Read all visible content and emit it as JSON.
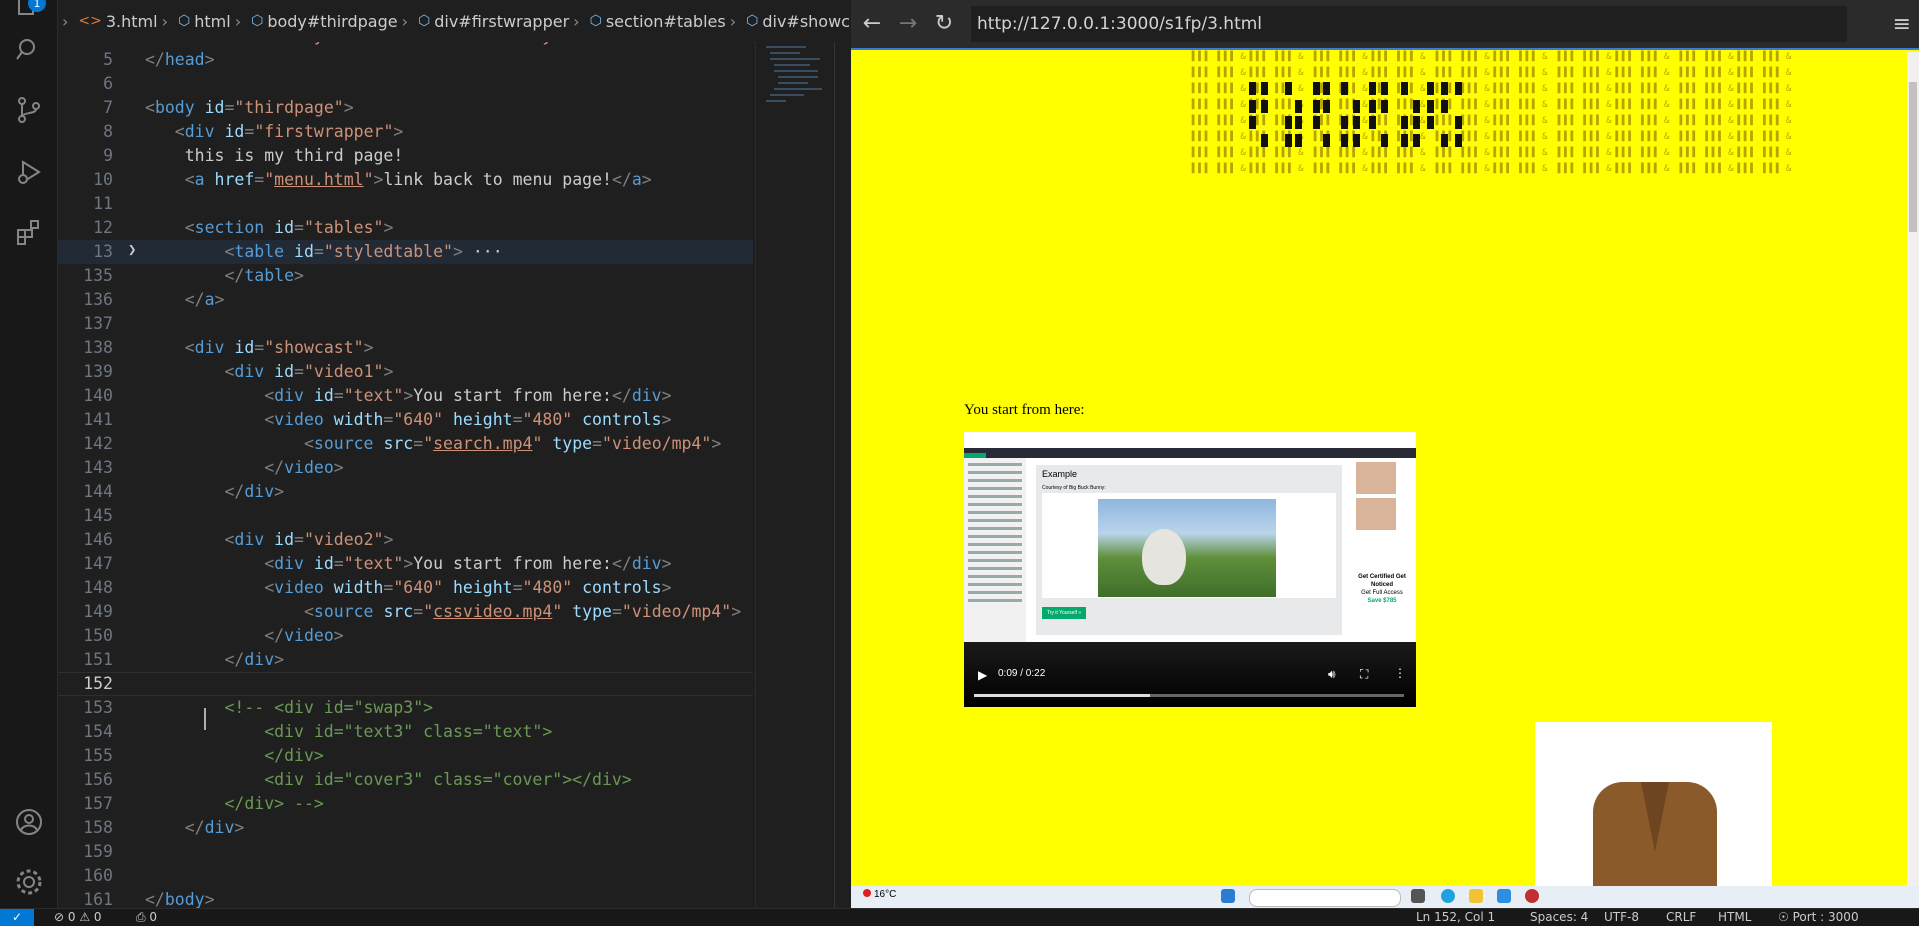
{
  "activity_bar": {
    "badge": "1"
  },
  "breadcrumb": [
    "3.html",
    "html",
    "body#thirdpage",
    "div#firstwrapper",
    "section#tables",
    "div#showcast"
  ],
  "editor": {
    "lines": [
      {
        "n": "",
        "parts": [
          [
            "p",
            "    <"
          ],
          [
            "t",
            "link "
          ],
          [
            "a",
            "rel"
          ],
          [
            "p",
            "="
          ],
          [
            "s",
            "\"stylesheet\" "
          ],
          [
            "a",
            "href"
          ],
          [
            "p",
            "="
          ],
          [
            "s",
            "\"thirdstyle.css\""
          ],
          [
            "p",
            " >"
          ]
        ]
      },
      {
        "n": "5",
        "parts": [
          [
            "p",
            "</"
          ],
          [
            "t",
            "head"
          ],
          [
            "p",
            ">"
          ]
        ]
      },
      {
        "n": "6",
        "parts": []
      },
      {
        "n": "7",
        "parts": [
          [
            "p",
            "<"
          ],
          [
            "t",
            "body "
          ],
          [
            "a",
            "id"
          ],
          [
            "p",
            "="
          ],
          [
            "s",
            "\"thirdpage\""
          ],
          [
            "p",
            ">"
          ]
        ]
      },
      {
        "n": "8",
        "parts": [
          [
            "p",
            "   <"
          ],
          [
            "t",
            "div "
          ],
          [
            "a",
            "id"
          ],
          [
            "p",
            "="
          ],
          [
            "s",
            "\"firstwrapper\""
          ],
          [
            "p",
            ">"
          ]
        ]
      },
      {
        "n": "9",
        "parts": [
          [
            "txt",
            "    this is my third page!"
          ]
        ]
      },
      {
        "n": "10",
        "parts": [
          [
            "p",
            "    <"
          ],
          [
            "t",
            "a "
          ],
          [
            "a",
            "href"
          ],
          [
            "p",
            "="
          ],
          [
            "s",
            "\""
          ],
          [
            "su",
            "menu.html"
          ],
          [
            "s",
            "\""
          ],
          [
            "p",
            ">"
          ],
          [
            "txt",
            "link back to menu page!"
          ],
          [
            "p",
            "</"
          ],
          [
            "t",
            "a"
          ],
          [
            "p",
            ">"
          ]
        ]
      },
      {
        "n": "11",
        "parts": []
      },
      {
        "n": "12",
        "parts": [
          [
            "p",
            "    <"
          ],
          [
            "t",
            "section "
          ],
          [
            "a",
            "id"
          ],
          [
            "p",
            "="
          ],
          [
            "s",
            "\"tables\""
          ],
          [
            "p",
            ">"
          ]
        ]
      },
      {
        "n": "13",
        "parts": [
          [
            "p",
            "        <"
          ],
          [
            "t",
            "table "
          ],
          [
            "a",
            "id"
          ],
          [
            "p",
            "="
          ],
          [
            "s",
            "\"styledtable\""
          ],
          [
            "p",
            ">"
          ],
          [
            "txt",
            " ···"
          ]
        ]
      },
      {
        "n": "135",
        "parts": [
          [
            "p",
            "        </"
          ],
          [
            "t",
            "table"
          ],
          [
            "p",
            ">"
          ]
        ]
      },
      {
        "n": "136",
        "parts": [
          [
            "p",
            "    </"
          ],
          [
            "t",
            "a"
          ],
          [
            "p",
            ">"
          ]
        ]
      },
      {
        "n": "137",
        "parts": []
      },
      {
        "n": "138",
        "parts": [
          [
            "p",
            "    <"
          ],
          [
            "t",
            "div "
          ],
          [
            "a",
            "id"
          ],
          [
            "p",
            "="
          ],
          [
            "s",
            "\"showcast\""
          ],
          [
            "p",
            ">"
          ]
        ]
      },
      {
        "n": "139",
        "parts": [
          [
            "p",
            "        <"
          ],
          [
            "t",
            "div "
          ],
          [
            "a",
            "id"
          ],
          [
            "p",
            "="
          ],
          [
            "s",
            "\"video1\""
          ],
          [
            "p",
            ">"
          ]
        ]
      },
      {
        "n": "140",
        "parts": [
          [
            "p",
            "            <"
          ],
          [
            "t",
            "div "
          ],
          [
            "a",
            "id"
          ],
          [
            "p",
            "="
          ],
          [
            "s",
            "\"text\""
          ],
          [
            "p",
            ">"
          ],
          [
            "txt",
            "You start from here:"
          ],
          [
            "p",
            "</"
          ],
          [
            "t",
            "div"
          ],
          [
            "p",
            ">"
          ]
        ]
      },
      {
        "n": "141",
        "parts": [
          [
            "p",
            "            <"
          ],
          [
            "t",
            "video "
          ],
          [
            "a",
            "width"
          ],
          [
            "p",
            "="
          ],
          [
            "s",
            "\"640\" "
          ],
          [
            "a",
            "height"
          ],
          [
            "p",
            "="
          ],
          [
            "s",
            "\"480\" "
          ],
          [
            "a",
            "controls"
          ],
          [
            "p",
            ">"
          ]
        ]
      },
      {
        "n": "142",
        "parts": [
          [
            "p",
            "                <"
          ],
          [
            "t",
            "source "
          ],
          [
            "a",
            "src"
          ],
          [
            "p",
            "="
          ],
          [
            "s",
            "\""
          ],
          [
            "su",
            "search.mp4"
          ],
          [
            "s",
            "\" "
          ],
          [
            "a",
            "type"
          ],
          [
            "p",
            "="
          ],
          [
            "s",
            "\"video/mp4\""
          ],
          [
            "p",
            ">"
          ]
        ]
      },
      {
        "n": "143",
        "parts": [
          [
            "p",
            "            </"
          ],
          [
            "t",
            "video"
          ],
          [
            "p",
            ">"
          ]
        ]
      },
      {
        "n": "144",
        "parts": [
          [
            "p",
            "        </"
          ],
          [
            "t",
            "div"
          ],
          [
            "p",
            ">"
          ]
        ]
      },
      {
        "n": "145",
        "parts": []
      },
      {
        "n": "146",
        "parts": [
          [
            "p",
            "        <"
          ],
          [
            "t",
            "div "
          ],
          [
            "a",
            "id"
          ],
          [
            "p",
            "="
          ],
          [
            "s",
            "\"video2\""
          ],
          [
            "p",
            ">"
          ]
        ]
      },
      {
        "n": "147",
        "parts": [
          [
            "p",
            "            <"
          ],
          [
            "t",
            "div "
          ],
          [
            "a",
            "id"
          ],
          [
            "p",
            "="
          ],
          [
            "s",
            "\"text\""
          ],
          [
            "p",
            ">"
          ],
          [
            "txt",
            "You start from here:"
          ],
          [
            "p",
            "</"
          ],
          [
            "t",
            "div"
          ],
          [
            "p",
            ">"
          ]
        ]
      },
      {
        "n": "148",
        "parts": [
          [
            "p",
            "            <"
          ],
          [
            "t",
            "video "
          ],
          [
            "a",
            "width"
          ],
          [
            "p",
            "="
          ],
          [
            "s",
            "\"640\" "
          ],
          [
            "a",
            "height"
          ],
          [
            "p",
            "="
          ],
          [
            "s",
            "\"480\" "
          ],
          [
            "a",
            "controls"
          ],
          [
            "p",
            ">"
          ]
        ]
      },
      {
        "n": "149",
        "parts": [
          [
            "p",
            "                <"
          ],
          [
            "t",
            "source "
          ],
          [
            "a",
            "src"
          ],
          [
            "p",
            "="
          ],
          [
            "s",
            "\""
          ],
          [
            "su",
            "cssvideo.mp4"
          ],
          [
            "s",
            "\" "
          ],
          [
            "a",
            "type"
          ],
          [
            "p",
            "="
          ],
          [
            "s",
            "\"video/mp4\""
          ],
          [
            "p",
            ">"
          ]
        ]
      },
      {
        "n": "150",
        "parts": [
          [
            "p",
            "            </"
          ],
          [
            "t",
            "video"
          ],
          [
            "p",
            ">"
          ]
        ]
      },
      {
        "n": "151",
        "parts": [
          [
            "p",
            "        </"
          ],
          [
            "t",
            "div"
          ],
          [
            "p",
            ">"
          ]
        ]
      },
      {
        "n": "152",
        "parts": []
      },
      {
        "n": "153",
        "parts": [
          [
            "c",
            "        <!-- <div id=\"swap3\">"
          ]
        ]
      },
      {
        "n": "154",
        "parts": [
          [
            "c",
            "            <div id=\"text3\" class=\"text\">"
          ]
        ]
      },
      {
        "n": "155",
        "parts": [
          [
            "c",
            "            </div>"
          ]
        ]
      },
      {
        "n": "156",
        "parts": [
          [
            "c",
            "            <div id=\"cover3\" class=\"cover\"></div>"
          ]
        ]
      },
      {
        "n": "157",
        "parts": [
          [
            "c",
            "        </div> -->"
          ]
        ]
      },
      {
        "n": "158",
        "parts": [
          [
            "p",
            "    </"
          ],
          [
            "t",
            "div"
          ],
          [
            "p",
            ">"
          ]
        ]
      },
      {
        "n": "159",
        "parts": []
      },
      {
        "n": "160",
        "parts": []
      },
      {
        "n": "161",
        "parts": [
          [
            "p",
            "</"
          ],
          [
            "t",
            "body"
          ],
          [
            "p",
            ">"
          ]
        ]
      }
    ]
  },
  "browser": {
    "url": "http://127.0.0.1:3000/s1fp/3.html",
    "video_caption": "You start from here:",
    "video": {
      "time": "0:09 / 0:22",
      "progress": 0.41,
      "screen_heading": "Example",
      "screen_sub": "Courtesy of Big Buck Bunny:",
      "screen_button": "Try it Yourself »",
      "ad_text": "Get Certified Get Noticed",
      "ad_sub": "Get Full Access",
      "ad_price": "Save $785"
    },
    "taskbar": {
      "weather": "16°C"
    }
  },
  "status_bar": {
    "problems": "⊘ 0 ⚠ 0",
    "ports": "⎙ 0",
    "position": "Ln 152, Col 1",
    "spaces": "Spaces: 4",
    "encoding": "UTF-8",
    "eol": "CRLF",
    "language": "HTML",
    "port": "☉ Port : 3000"
  }
}
